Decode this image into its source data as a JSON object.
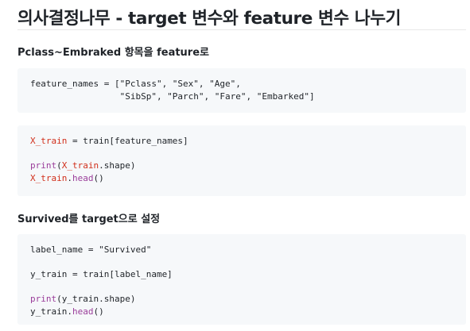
{
  "page": {
    "title": "의사결정나무 - target 변수와 feature 변수 나누기"
  },
  "sections": [
    {
      "heading": "Pclass~Embraked 항목을 feature로",
      "blocks": [
        {
          "lines": [
            [
              {
                "t": "plain",
                "text": "feature_names = [\"Pclass\", \"Sex\", \"Age\","
              }
            ],
            [
              {
                "t": "plain",
                "text": "                 \"SibSp\", \"Parch\", \"Fare\", \"Embarked\"]"
              }
            ]
          ]
        },
        {
          "lines": [
            [
              {
                "t": "var",
                "text": "X_train"
              },
              {
                "t": "plain",
                "text": " = train[feature_names]"
              }
            ],
            [],
            [
              {
                "t": "fn",
                "text": "print"
              },
              {
                "t": "plain",
                "text": "("
              },
              {
                "t": "var",
                "text": "X_train"
              },
              {
                "t": "plain",
                "text": ".shape)"
              }
            ],
            [
              {
                "t": "var",
                "text": "X_train"
              },
              {
                "t": "plain",
                "text": "."
              },
              {
                "t": "fn",
                "text": "head"
              },
              {
                "t": "plain",
                "text": "()"
              }
            ]
          ]
        }
      ]
    },
    {
      "heading": "Survived를 target으로 설정",
      "blocks": [
        {
          "lines": [
            [
              {
                "t": "plain",
                "text": "label_name = \"Survived\""
              }
            ],
            [],
            [
              {
                "t": "plain",
                "text": "y_train = train[label_name]"
              }
            ],
            [],
            [
              {
                "t": "fn",
                "text": "print"
              },
              {
                "t": "plain",
                "text": "(y_train.shape)"
              }
            ],
            [
              {
                "t": "plain",
                "text": "y_train."
              },
              {
                "t": "fn",
                "text": "head"
              },
              {
                "t": "plain",
                "text": "()"
              }
            ]
          ]
        }
      ]
    }
  ]
}
